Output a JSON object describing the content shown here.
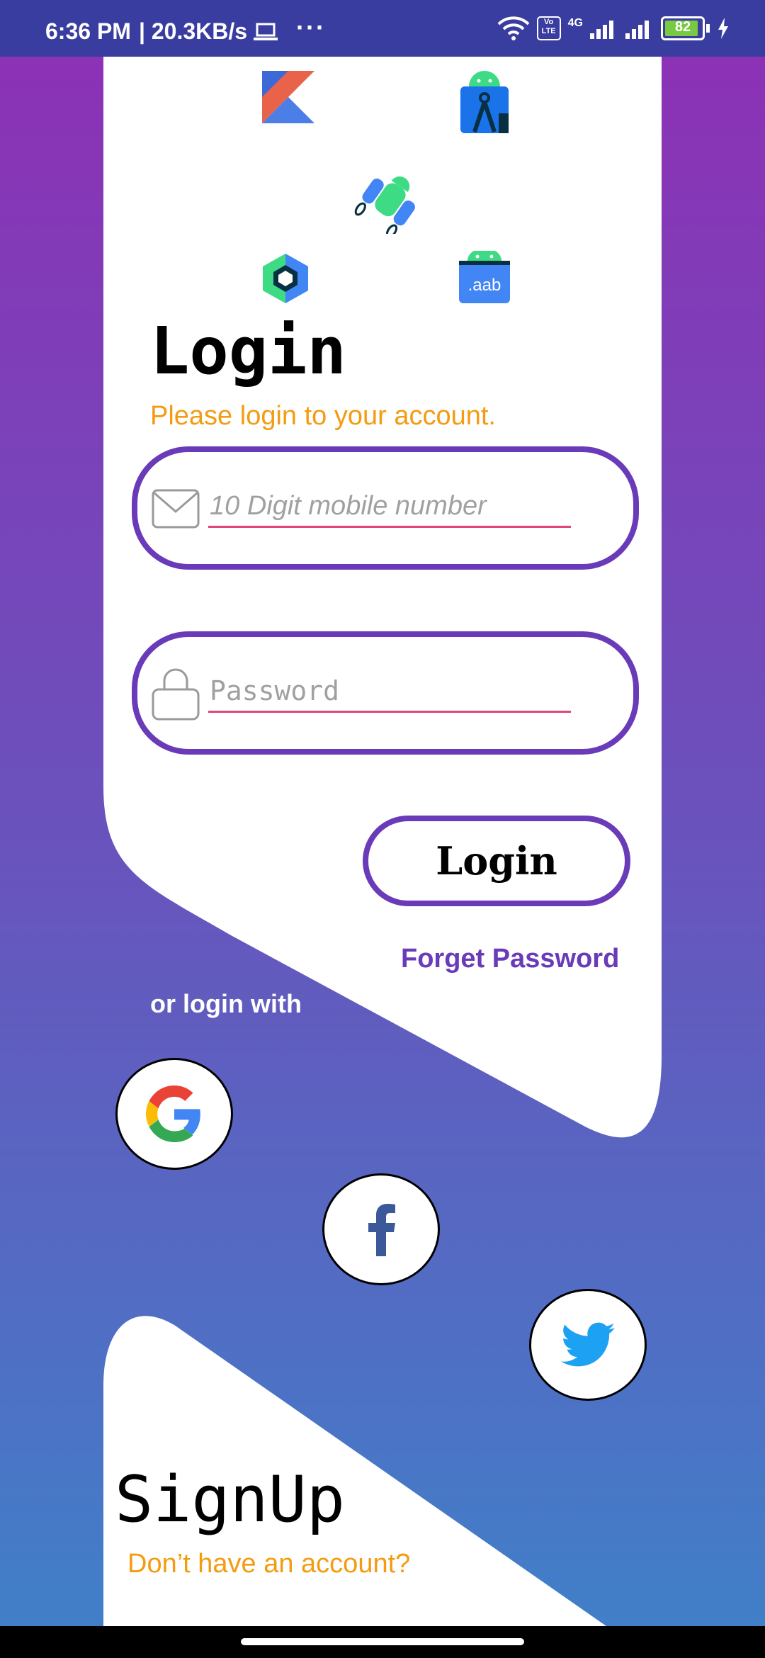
{
  "status_bar": {
    "time": "6:36 PM",
    "speed": "| 20.3KB/s",
    "dots": "···",
    "battery": "82",
    "network_label": "4G",
    "volte_label": "Vo LTE"
  },
  "login": {
    "title": "Login",
    "subtitle": "Please login to your account.",
    "phone_placeholder": "10 Digit mobile number",
    "password_placeholder": "Password",
    "login_button": "Login",
    "forget_password": "Forget Password",
    "or_login_with": "or login with"
  },
  "signup": {
    "title": "SignUp",
    "subtitle": "Don’t have an account?"
  },
  "colors": {
    "accent_purple": "#6a3bb8",
    "orange": "#f39c12",
    "underline_pink": "#e0457b",
    "gradient_top": "#8e2fb5",
    "gradient_bottom": "#3f81c9"
  },
  "logos": [
    "kotlin-icon",
    "android-studio-icon",
    "android-rocket-icon",
    "jetpack-compose-icon",
    "aab-bundle-icon"
  ],
  "social": [
    "google-icon",
    "facebook-icon",
    "twitter-icon"
  ]
}
